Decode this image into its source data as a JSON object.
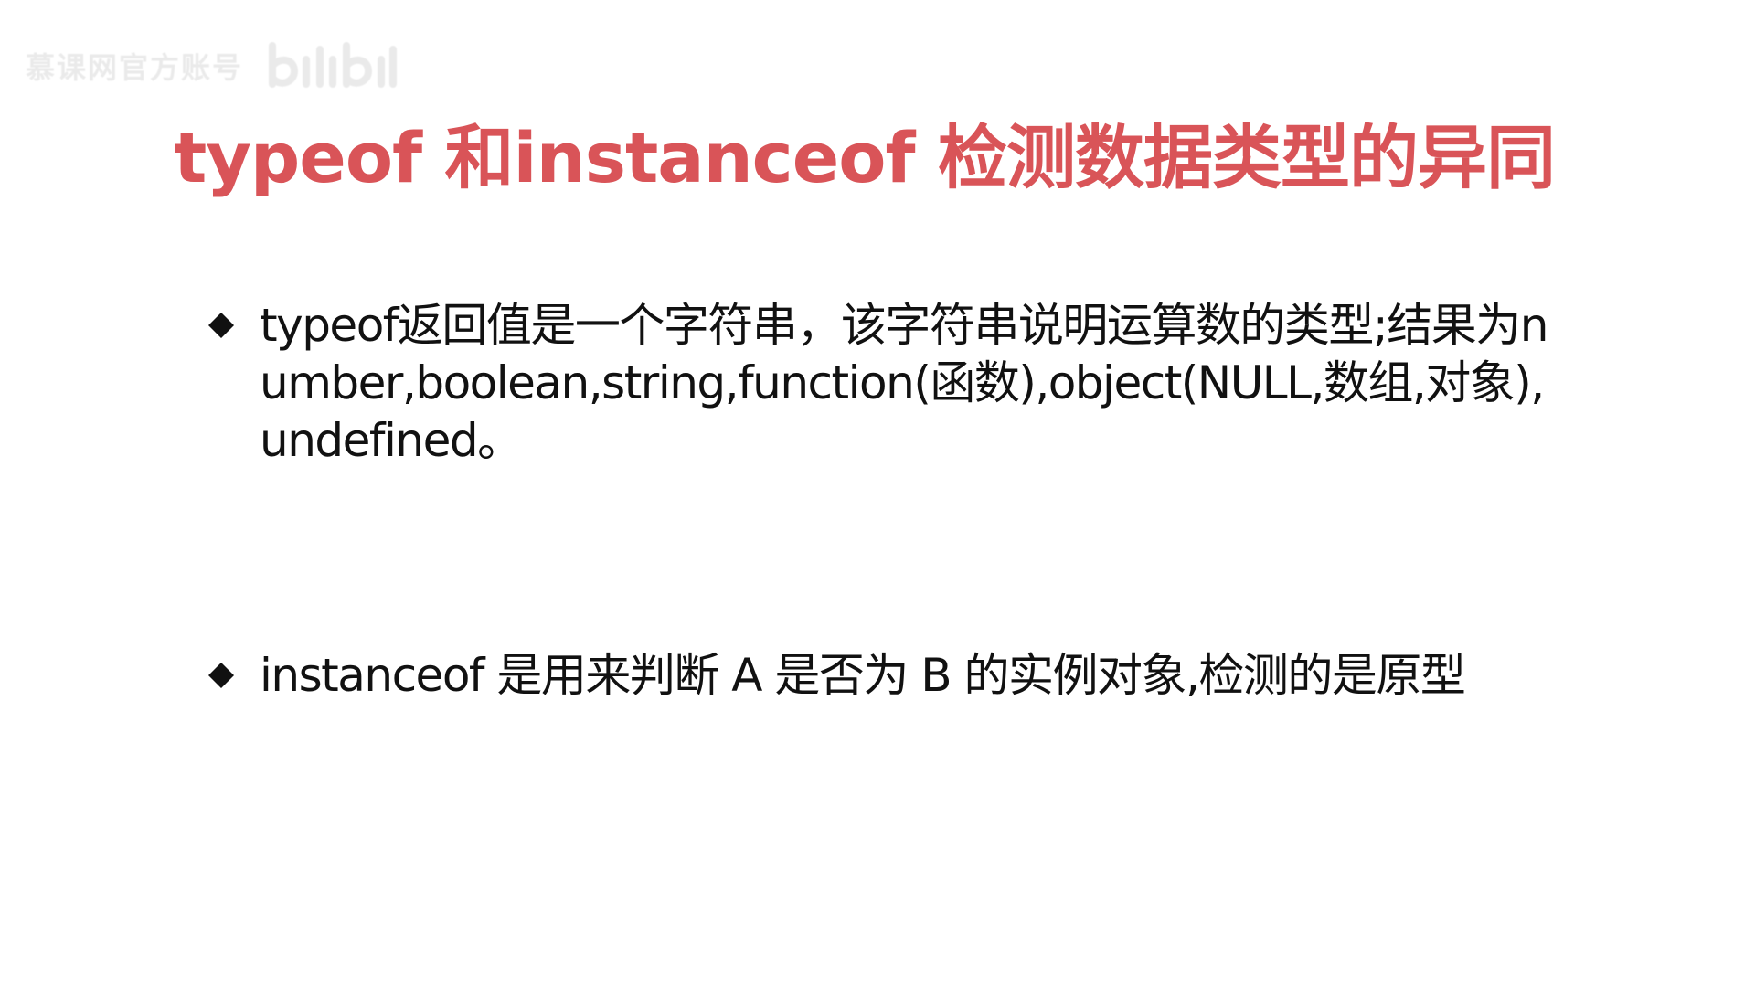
{
  "watermark": {
    "text": "慕课网官方账号",
    "logo_text": "bilibili"
  },
  "title": "typeof 和instanceof 检测数据类型的异同",
  "bullets": [
    {
      "text": "typeof返回值是一个字符串，该字符串说明运算数的类型;结果为number,boolean,string,function(函数),object(NULL,数组,对象),undefined。"
    },
    {
      "text": "instanceof 是用来判断 A 是否为 B 的实例对象,检测的是原型"
    }
  ],
  "colors": {
    "title": "#d95458",
    "text": "#111111",
    "bullet_marker": "#111111",
    "background": "#ffffff"
  },
  "icons": {
    "bullet": "diamond-bullet-icon",
    "watermark": "bilibili-logo-icon"
  }
}
